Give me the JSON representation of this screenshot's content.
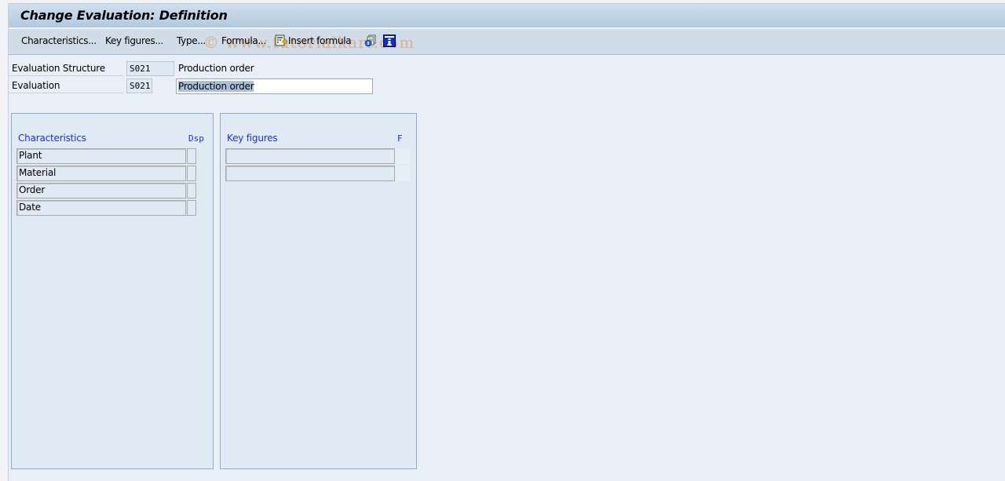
{
  "window": {
    "title": "Change Evaluation: Definition"
  },
  "toolbar": {
    "items": [
      {
        "label": "Characteristics...",
        "icon": null
      },
      {
        "label": "Key figures...",
        "icon": null
      },
      {
        "label": "Type...",
        "icon": null
      },
      {
        "label": "Formula...",
        "icon": null
      },
      {
        "label": "Insert formula",
        "icon": "insert-formula-icon"
      }
    ],
    "icon_buttons": [
      "display-document-icon",
      "info-icon"
    ],
    "watermark": "© www.tutorialkart.com"
  },
  "header": {
    "evaluation_structure": {
      "label": "Evaluation Structure",
      "code": "S021",
      "description": "Production order"
    },
    "evaluation": {
      "label": "Evaluation",
      "code": "S021",
      "description_value": "Production order"
    }
  },
  "characteristics_panel": {
    "column_header": "Characteristics",
    "display_header": "Dsp",
    "rows": [
      {
        "name": "Plant",
        "dsp": false
      },
      {
        "name": "Material",
        "dsp": false
      },
      {
        "name": "Order",
        "dsp": false
      },
      {
        "name": "Date",
        "dsp": false
      }
    ]
  },
  "key_figures_panel": {
    "column_header": "Key figures",
    "formula_header": "F",
    "rows": [
      {
        "name": "",
        "f": ""
      },
      {
        "name": "",
        "f": ""
      }
    ]
  },
  "colors": {
    "title_gradient_top": "#d0e0ee",
    "title_gradient_bottom": "#b2c9de",
    "toolbar_bg": "#d0dde8",
    "content_bg": "#e8eff7",
    "panel_bg": "#dfeaf4",
    "panel_border": "#8eacc8",
    "column_header_text": "#1e2ee0",
    "selection": "#a9c0dc"
  }
}
